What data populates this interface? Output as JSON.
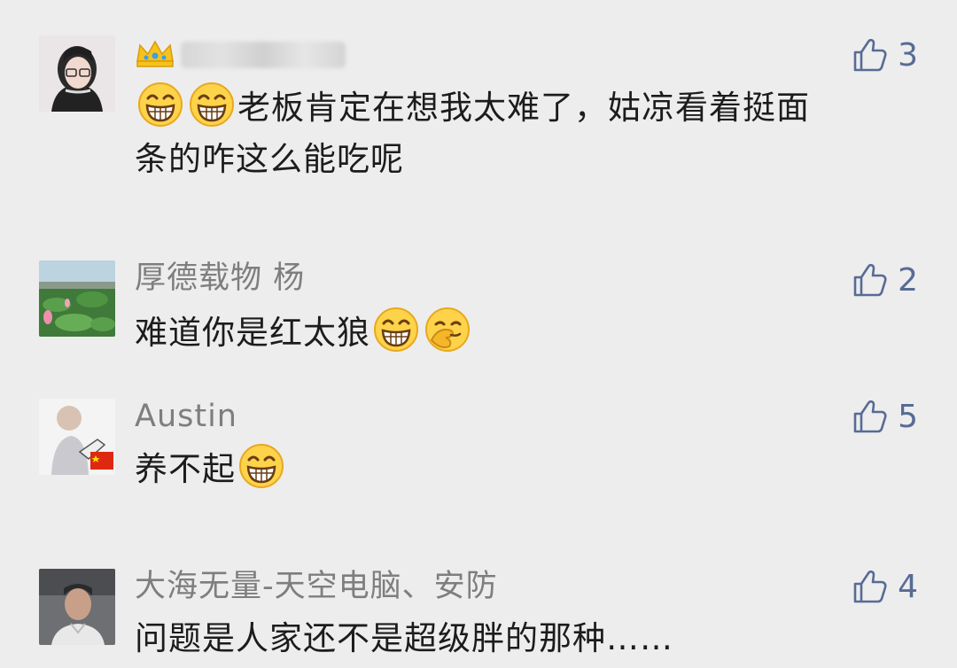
{
  "comments": [
    {
      "name": "",
      "text_line1": "老板肯定在想我太难了，姑凉看着挺面",
      "text_line2": "条的咋这么能吃呢",
      "likes": "3",
      "avatar": "anime-girl-avatar",
      "emojis_before": [
        "grin-emoji",
        "grin-emoji"
      ]
    },
    {
      "name": "厚德载物 杨",
      "text": "难道你是红太狼",
      "likes": "2",
      "avatar": "lotus-pond-avatar",
      "emojis_after": [
        "grin-emoji",
        "facepalm-emoji"
      ]
    },
    {
      "name": "Austin",
      "text": "养不起",
      "likes": "5",
      "avatar": "child-with-flag-avatar",
      "emojis_after": [
        "grin-emoji"
      ]
    },
    {
      "name": "大海无量-天空电脑、安防",
      "text": "问题是人家还不是超级胖的那种……",
      "likes": "4",
      "avatar": "man-in-car-avatar"
    }
  ],
  "colors": {
    "background": "#ededed",
    "name": "#7e7e7e",
    "text": "#1c1c1c",
    "like": "#576b95"
  }
}
